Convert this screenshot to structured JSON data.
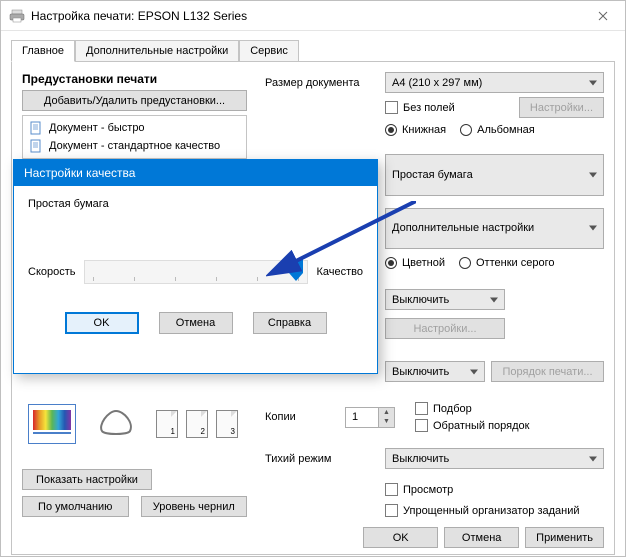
{
  "window_title": "Настройка печати: EPSON L132 Series",
  "tabs": {
    "main": "Главное",
    "more": "Дополнительные настройки",
    "service": "Сервис"
  },
  "presets": {
    "title": "Предустановки печати",
    "add_remove": "Добавить/Удалить предустановки...",
    "items": [
      "Документ - быстро",
      "Документ - стандартное качество"
    ]
  },
  "right": {
    "size_label": "Размер документа",
    "size_value": "A4 (210 x 297 мм)",
    "borderless": "Без полей",
    "settings": "Настройки...",
    "portrait": "Книжная",
    "landscape": "Альбомная",
    "paper_value": "Простая бумага",
    "extra_value": "Дополнительные настройки",
    "color": "Цветной",
    "gray": "Оттенки серого",
    "off1": "Выключить",
    "settings2": "Настройки...",
    "off2": "Выключить",
    "print_order": "Порядок печати...",
    "copies_label": "Копии",
    "copies_value": "1",
    "collate": "Подбор",
    "reverse": "Обратный порядок",
    "quiet_label": "Тихий режим",
    "quiet_value": "Выключить",
    "preview": "Просмотр",
    "organizer": "Упрощенный организатор заданий"
  },
  "bottom_left": {
    "show": "Показать настройки",
    "default": "По умолчанию",
    "ink": "Уровень чернил"
  },
  "footer": {
    "ok": "OK",
    "cancel": "Отмена",
    "apply": "Применить"
  },
  "modal": {
    "title": "Настройки качества",
    "paper": "Простая бумага",
    "left": "Скорость",
    "right": "Качество",
    "ok": "OK",
    "cancel": "Отмена",
    "help": "Справка"
  }
}
